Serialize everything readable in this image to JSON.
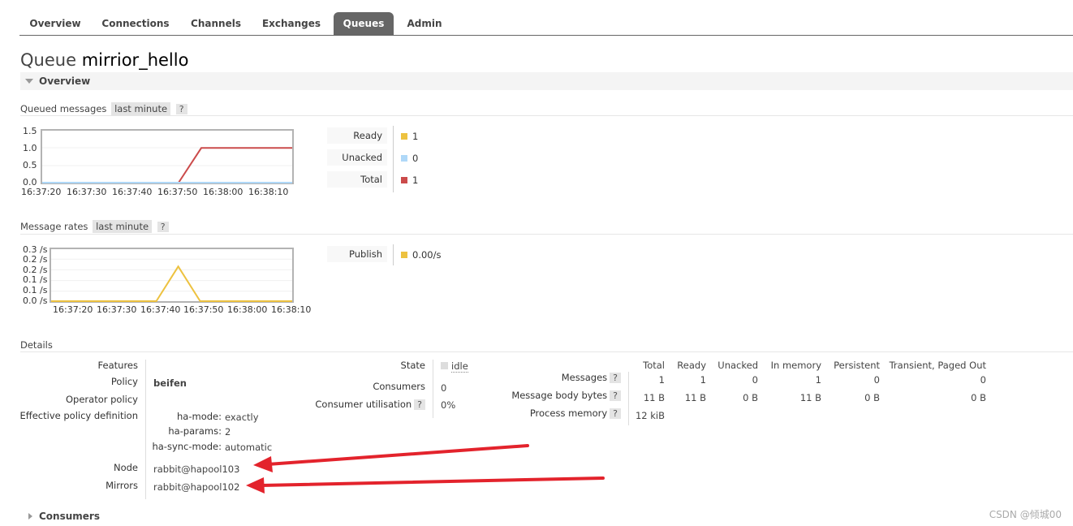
{
  "tabs": [
    {
      "label": "Overview",
      "active": false
    },
    {
      "label": "Connections",
      "active": false
    },
    {
      "label": "Channels",
      "active": false
    },
    {
      "label": "Exchanges",
      "active": false
    },
    {
      "label": "Queues",
      "active": true
    },
    {
      "label": "Admin",
      "active": false
    }
  ],
  "page": {
    "title_prefix": "Queue",
    "queue_name": "mirrior_hello"
  },
  "overview_section": {
    "label": "Overview",
    "icon": "triangle-down-icon"
  },
  "queued_messages": {
    "label": "Queued messages",
    "range": "last minute",
    "help": "?",
    "legend": [
      {
        "label": "Ready",
        "value": "1",
        "color": "#edc240"
      },
      {
        "label": "Unacked",
        "value": "0",
        "color": "#afd8f8"
      },
      {
        "label": "Total",
        "value": "1",
        "color": "#cb4b4b"
      }
    ]
  },
  "message_rates": {
    "label": "Message rates",
    "range": "last minute",
    "help": "?",
    "legend": [
      {
        "label": "Publish",
        "value": "0.00/s",
        "color": "#edc240"
      }
    ]
  },
  "chart_data": [
    {
      "type": "line",
      "title": "Queued messages",
      "x": [
        "16:37:20",
        "16:37:30",
        "16:37:40",
        "16:37:50",
        "16:38:00",
        "16:38:10"
      ],
      "ytick_labels": [
        "1.5",
        "1.0",
        "0.5",
        "0.0"
      ],
      "ylim": [
        0,
        1.5
      ],
      "series": [
        {
          "name": "Total",
          "color": "#cb4b4b",
          "points": [
            [
              0,
              0
            ],
            [
              10,
              0
            ],
            [
              20,
              0
            ],
            [
              30,
              0
            ],
            [
              35,
              1
            ],
            [
              40,
              1
            ],
            [
              50,
              1
            ],
            [
              55,
              1
            ]
          ]
        },
        {
          "name": "Unacked",
          "color": "#afd8f8",
          "points": [
            [
              0,
              0
            ],
            [
              55,
              0
            ]
          ]
        }
      ]
    },
    {
      "type": "line",
      "title": "Message rates",
      "x": [
        "16:37:20",
        "16:37:30",
        "16:37:40",
        "16:37:50",
        "16:38:00",
        "16:38:10"
      ],
      "ytick_labels": [
        "0.3 /s",
        "0.2 /s",
        "0.2 /s",
        "0.1 /s",
        "0.1 /s",
        "0.0 /s"
      ],
      "ylim": [
        0,
        0.3
      ],
      "series": [
        {
          "name": "Publish",
          "color": "#edc240",
          "points": [
            [
              0,
              0
            ],
            [
              24,
              0
            ],
            [
              29,
              0.2
            ],
            [
              34,
              0
            ],
            [
              55,
              0
            ]
          ]
        }
      ]
    }
  ],
  "details": {
    "label": "Details",
    "features_label": "Features",
    "policy_label": "Policy",
    "policy_value": "beifen",
    "operator_policy_label": "Operator policy",
    "effective_policy_label": "Effective policy definition",
    "ha_mode_label": "ha-mode:",
    "ha_mode_value": "exactly",
    "ha_params_label": "ha-params:",
    "ha_params_value": "2",
    "ha_sync_label": "ha-sync-mode:",
    "ha_sync_value": "automatic",
    "node_label": "Node",
    "node_value": "rabbit@hapool103",
    "mirrors_label": "Mirrors",
    "mirrors_value": "rabbit@hapool102",
    "state_label": "State",
    "state_value": "idle",
    "consumers_label": "Consumers",
    "consumers_value": "0",
    "utilisation_label": "Consumer utilisation",
    "utilisation_value": "0%",
    "stats_headers": [
      "Total",
      "Ready",
      "Unacked",
      "In memory",
      "Persistent",
      "Transient, Paged Out"
    ],
    "stats_rows": [
      {
        "label": "Messages",
        "values": [
          "1",
          "1",
          "0",
          "1",
          "0",
          "0"
        ]
      },
      {
        "label": "Message body bytes",
        "values": [
          "11 B",
          "11 B",
          "0 B",
          "11 B",
          "0 B",
          "0 B"
        ]
      },
      {
        "label": "Process memory",
        "values": [
          "12 kiB"
        ]
      }
    ]
  },
  "consumers_section": {
    "label": "Consumers",
    "icon": "triangle-right-icon"
  },
  "watermark": "CSDN @倾城00",
  "annotation_color": "#e3232c"
}
